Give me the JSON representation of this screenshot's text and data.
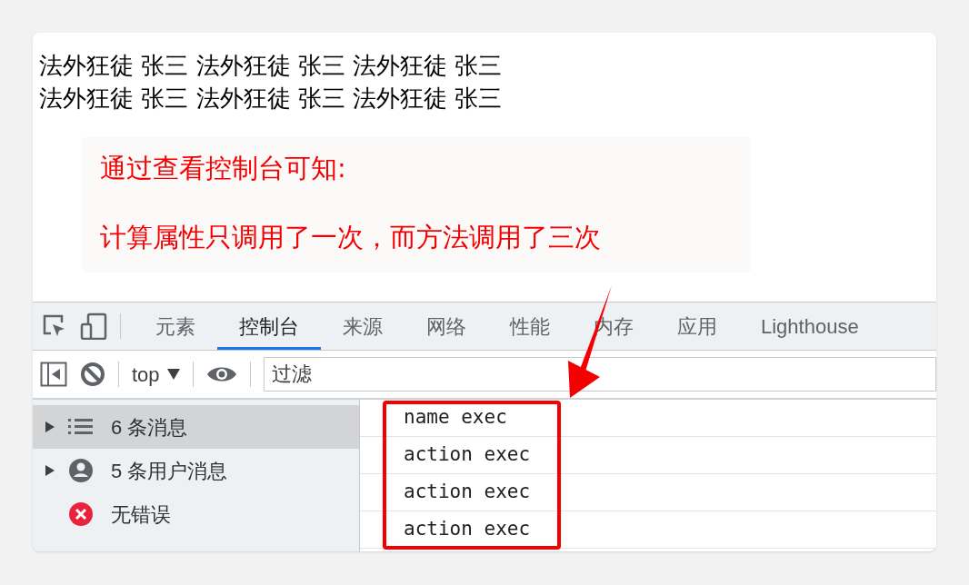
{
  "page": {
    "lines": [
      "法外狂徒 张三 法外狂徒 张三 法外狂徒 张三",
      "法外狂徒 张三 法外狂徒 张三 法外狂徒 张三"
    ]
  },
  "annotation": {
    "lines": [
      "通过查看控制台可知:",
      "计算属性只调用了一次，而方法调用了三次"
    ]
  },
  "devtools": {
    "tabs": [
      {
        "label": "元素",
        "selected": false
      },
      {
        "label": "控制台",
        "selected": true
      },
      {
        "label": "来源",
        "selected": false
      },
      {
        "label": "网络",
        "selected": false
      },
      {
        "label": "性能",
        "selected": false
      },
      {
        "label": "内存",
        "selected": false
      },
      {
        "label": "应用",
        "selected": false
      },
      {
        "label": "Lighthouse",
        "selected": false
      }
    ],
    "toolbar": {
      "context": "top",
      "filter_placeholder": "过滤"
    },
    "sidebar": [
      {
        "kind": "messages",
        "label": "6 条消息",
        "expandable": true,
        "selected": true
      },
      {
        "kind": "user",
        "label": "5 条用户消息",
        "expandable": true,
        "selected": false
      },
      {
        "kind": "error",
        "label": "无错误",
        "expandable": false,
        "selected": false
      }
    ],
    "console": [
      "name exec",
      "action exec",
      "action exec",
      "action exec"
    ]
  }
}
